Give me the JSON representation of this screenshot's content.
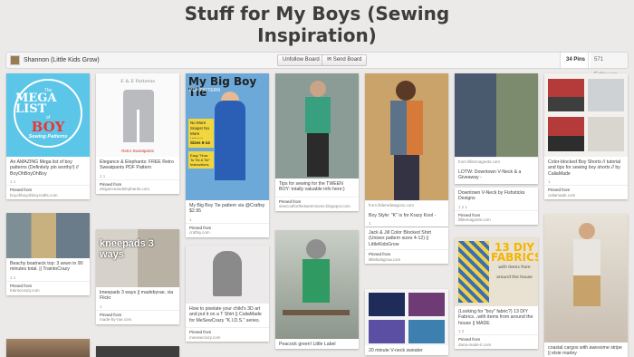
{
  "board": {
    "title_line1": "Stuff for My Boys (Sewing",
    "title_line2": "Inspiration)",
    "owner": "Shannon (Little Kids Grow)",
    "unfollow_label": "Unfollow Board",
    "send_label": "Send Board",
    "pins_count": "34 Pins",
    "followers_count": "571 Followers"
  },
  "pins": [
    {
      "desc": "An AMAZING Mega list of boy patterns (Definitely pin worthy!) // BoyOhBoyOhBoy",
      "meta": "1 1",
      "src_label": "Pinned from",
      "src": "boyohboyohboycrafts.com",
      "art": {
        "t1": "The",
        "t2": "MEGA LIST",
        "t2b": "of",
        "t3": "BOY",
        "t4": "Sewing Patterns"
      }
    },
    {
      "desc": "Elegance & Elephants: FREE Retro Sweatpants PDF Pattern",
      "meta": "1 1",
      "src_label": "Pinned from",
      "src": "eleganceandelephants.com",
      "art": {
        "title": "E & E Patterns",
        "footer": "Retro Sweatpants"
      }
    },
    {
      "desc": "My Big Boy Tie pattern via @Craftsy $2.95",
      "meta": "1",
      "src_label": "Pinned from",
      "src": "craftsy.com",
      "art": {
        "h1": "My Big Boy Tie",
        "h2": "PDF PATTERN",
        "tag": "No More Snaps! No More Velcro!",
        "sizes": "Sizes 6-14",
        "tag2": "Easy \"How To Tie A Tie\" Instructions"
      }
    },
    {
      "desc": "Tips for sewing for the TWEEN BOY: totally valuable info here:)",
      "meta": "",
      "src_label": "Pinned from",
      "src": "sewcoolforthetweensome.blogspot.com"
    },
    {
      "desc": "Boy Style: \"K\" is for Krazy Kool -",
      "meta": "1",
      "src_label": "from littleredwagonx.com",
      "src": "Pinned from littleredwagonx.com"
    },
    {
      "desc": "LOTW: Downtown V-Neck & a Giveaway -",
      "meta": "",
      "src_label": "from lillitemagnets.com",
      "src": ""
    },
    {
      "desc": "Color-blocked Boy Shorts // tutorial and tips for sewing boy shorts // by CaliaMade",
      "meta": "1",
      "src_label": "Pinned from",
      "src": "caliamade.com"
    },
    {
      "desc": "Beachy boatneck top: 3 sewn in 90 minutes total. || TraintoCrazy",
      "meta": "1 1",
      "src_label": "Pinned from",
      "src": "traintocrazy.com"
    },
    {
      "desc": "kneepads 3 ways || madebyrae, via Flickr",
      "meta": "1",
      "src_label": "Pinned from",
      "src": "made-by-rae.com",
      "art": {
        "k": "kneepads 3 ways"
      }
    },
    {
      "desc": "How to pixelate your child's 3D art and put it on a T Shirt || CaliaMade for MeSewCrazy \"K.I.D.S.\" series.",
      "meta": "",
      "src_label": "Pinned from",
      "src": "mesewcrazy.com"
    },
    {
      "desc": "Peacock green! Little Label",
      "meta": "",
      "src_label": "",
      "src": ""
    },
    {
      "desc": "Jack & Jill Color Blocked Shirt (Unisex pattern sizes 4-12) || LittleKidsGrow",
      "meta": "",
      "src_label": "Pinned from",
      "src": "littlekidsgrow.com"
    },
    {
      "desc": "Downtown V-Neck by Fishsticks Designs",
      "meta": "1 2 1",
      "src_label": "Pinned from",
      "src": "lillitemagnets.com"
    },
    {
      "desc": "(Looking for \"boy\" fabric?) 13 DIY Fabrics...with items from around the house || MADE",
      "meta": "1 2",
      "src_label": "Pinned from",
      "src": "dana-made-it.com",
      "art": {
        "big": "13 DIY FABRICS",
        "sub": "with items from around the house"
      }
    },
    {
      "desc": "20 minute V-neck sweater",
      "meta": "",
      "src_label": "",
      "src": ""
    },
    {
      "desc": "coastal cargos with awesome stripe || elsie marley",
      "meta": "",
      "src_label": "",
      "src": ""
    }
  ]
}
